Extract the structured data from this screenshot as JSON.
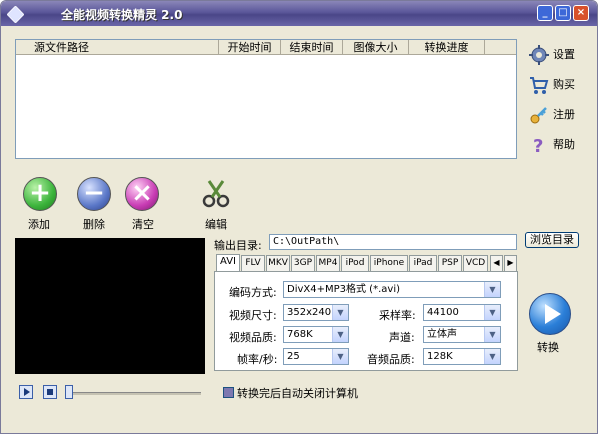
{
  "window": {
    "title": "全能视频转换精灵 2.0",
    "min_glyph": "_",
    "max_glyph": "□",
    "close_glyph": "×"
  },
  "file_list": {
    "columns": [
      "源文件路径",
      "开始时间",
      "结束时间",
      "图像大小",
      "转换进度"
    ]
  },
  "sidebar": {
    "settings": "设置",
    "buy": "购买",
    "register": "注册",
    "help": "帮助"
  },
  "actions": {
    "add": "添加",
    "delete": "删除",
    "clear": "清空",
    "edit": "编辑"
  },
  "output": {
    "label": "输出目录:",
    "path": "C:\\OutPath\\",
    "browse": "浏览目录"
  },
  "tabs": [
    "AVI",
    "FLV",
    "MKV",
    "3GP",
    "MP4",
    "iPod",
    "iPhone",
    "iPad",
    "PSP",
    "VCD"
  ],
  "settings": {
    "encoding_label": "编码方式:",
    "encoding_value": "DivX4+MP3格式 (*.avi)",
    "size_label": "视频尺寸:",
    "size_value": "352x240",
    "quality_label": "视频品质:",
    "quality_value": "768K",
    "fps_label": "帧率/秒:",
    "fps_value": "25",
    "samplerate_label": "采样率:",
    "samplerate_value": "44100",
    "channel_label": "声道:",
    "channel_value": "立体声",
    "audioquality_label": "音频品质:",
    "audioquality_value": "128K"
  },
  "convert_label": "转换",
  "auto_shutdown": {
    "label": "转换完后自动关闭计算机",
    "checked": true
  },
  "colors": {
    "title_bar": "#5b579a",
    "add_button": "#3cb43c",
    "delete_button": "#5b78c8",
    "clear_button": "#c83cb4",
    "convert_button": "#2b7fd8"
  }
}
